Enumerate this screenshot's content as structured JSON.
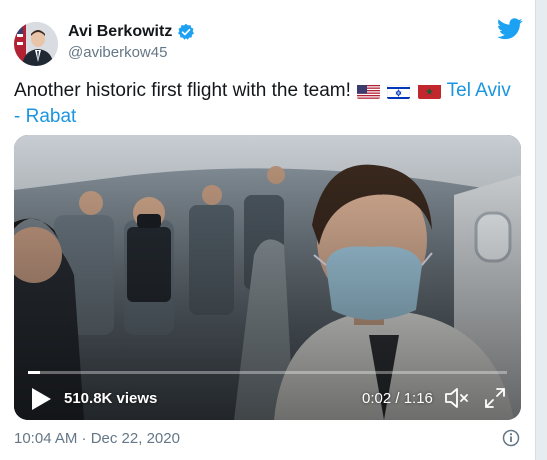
{
  "author": {
    "name": "Avi Berkowitz",
    "handle": "@aviberkow45"
  },
  "tweet": {
    "text": "Another historic first flight with the team!",
    "flags": [
      "us-flag-icon",
      "israel-flag-icon",
      "morocco-flag-icon"
    ],
    "route_line1": "Tel Aviv",
    "route_line2": "- Rabat"
  },
  "video": {
    "views": "510.8K views",
    "time": "0:02 / 1:16",
    "progress_fraction": 0.026
  },
  "footer": {
    "timestamp": "10:04 AM · Dec 22, 2020"
  },
  "colors": {
    "link": "#1b95e0",
    "twitter_blue": "#1da1f2",
    "verified": "#1da1f2"
  }
}
